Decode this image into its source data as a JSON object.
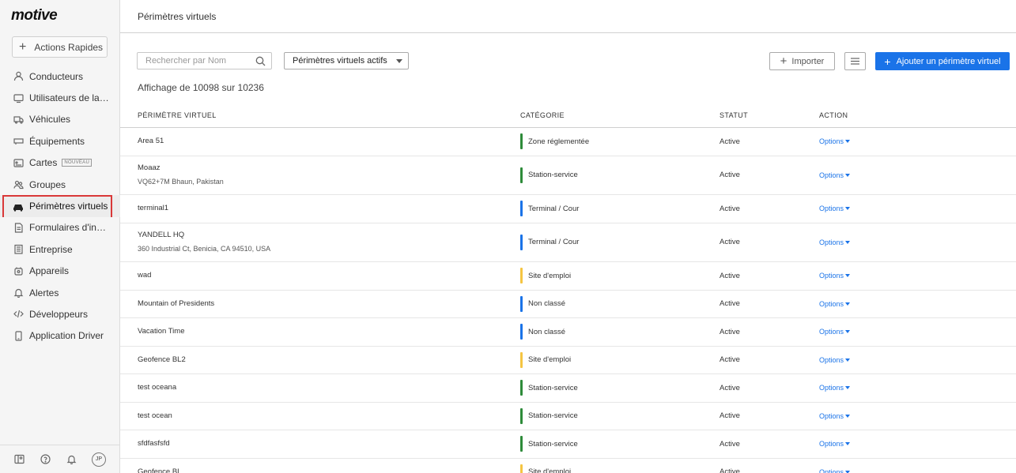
{
  "brand": {
    "logo": "motive"
  },
  "sidebar": {
    "quick_action": "Actions Rapides",
    "items": [
      {
        "label": "Conducteurs",
        "icon": "user-icon"
      },
      {
        "label": "Utilisateurs de la f...",
        "icon": "monitor-icon"
      },
      {
        "label": "Véhicules",
        "icon": "truck-icon"
      },
      {
        "label": "Équipements",
        "icon": "trailer-icon"
      },
      {
        "label": "Cartes",
        "icon": "map-card-icon",
        "badge": "NOUVEAU"
      },
      {
        "label": "Groupes",
        "icon": "groups-icon"
      },
      {
        "label": "Périmètres virtuels",
        "icon": "geofence-icon",
        "active": true
      },
      {
        "label": "Formulaires d'insp...",
        "icon": "form-icon"
      },
      {
        "label": "Entreprise",
        "icon": "building-icon"
      },
      {
        "label": "Appareils",
        "icon": "devices-icon"
      },
      {
        "label": "Alertes",
        "icon": "bell-icon"
      },
      {
        "label": "Développeurs",
        "icon": "code-icon"
      },
      {
        "label": "Application Driver",
        "icon": "phone-icon"
      }
    ],
    "footer": {
      "avatar": "JP"
    }
  },
  "header": {
    "title": "Périmètres virtuels"
  },
  "toolbar": {
    "search_placeholder": "Rechercher par Nom",
    "filter_value": "Périmètres virtuels actifs",
    "import_label": "Importer",
    "add_label": "Ajouter un périmètre virtuel"
  },
  "count_text": "Affichage de 10098 sur 10236",
  "table": {
    "headers": {
      "name": "PÉRIMÈTRE VIRTUEL",
      "category": "CATÉGORIE",
      "status": "STATUT",
      "action": "ACTION"
    },
    "rows": [
      {
        "name": "Area 51",
        "address": "",
        "category": "Zone réglementée",
        "status": "Active",
        "action": "Options"
      },
      {
        "name": "Moaaz",
        "address": "VQ62+7M Bhaun, Pakistan",
        "category": "Station-service",
        "status": "Active",
        "action": "Options"
      },
      {
        "name": "terminal1",
        "address": "",
        "category": "Terminal / Cour",
        "status": "Active",
        "action": "Options"
      },
      {
        "name": "YANDELL HQ",
        "address": "360 Industrial Ct, Benicia, CA 94510, USA",
        "category": "Terminal / Cour",
        "status": "Active",
        "action": "Options"
      },
      {
        "name": "wad",
        "address": "",
        "category": "Site d'emploi",
        "status": "Active",
        "action": "Options"
      },
      {
        "name": "Mountain of Presidents",
        "address": "",
        "category": "Non classé",
        "status": "Active",
        "action": "Options"
      },
      {
        "name": "Vacation Time",
        "address": "",
        "category": "Non classé",
        "status": "Active",
        "action": "Options"
      },
      {
        "name": "Geofence BL2",
        "address": "",
        "category": "Site d'emploi",
        "status": "Active",
        "action": "Options"
      },
      {
        "name": "test oceana",
        "address": "",
        "category": "Station-service",
        "status": "Active",
        "action": "Options"
      },
      {
        "name": "test ocean",
        "address": "",
        "category": "Station-service",
        "status": "Active",
        "action": "Options"
      },
      {
        "name": "sfdfasfsfd",
        "address": "",
        "category": "Station-service",
        "status": "Active",
        "action": "Options"
      },
      {
        "name": "Geofence BL",
        "address": "",
        "category": "Site d'emploi",
        "status": "Active",
        "action": "Options"
      }
    ]
  },
  "colors": {
    "accent": "#1a73e8",
    "active_highlight": "#d93838",
    "category": {
      "Zone réglementée": "#2e8b3a",
      "Station-service": "#2e8b3a",
      "Terminal / Cour": "#1a73e8",
      "Site d'emploi": "#f5c542",
      "Non classé": "#1a73e8"
    }
  }
}
